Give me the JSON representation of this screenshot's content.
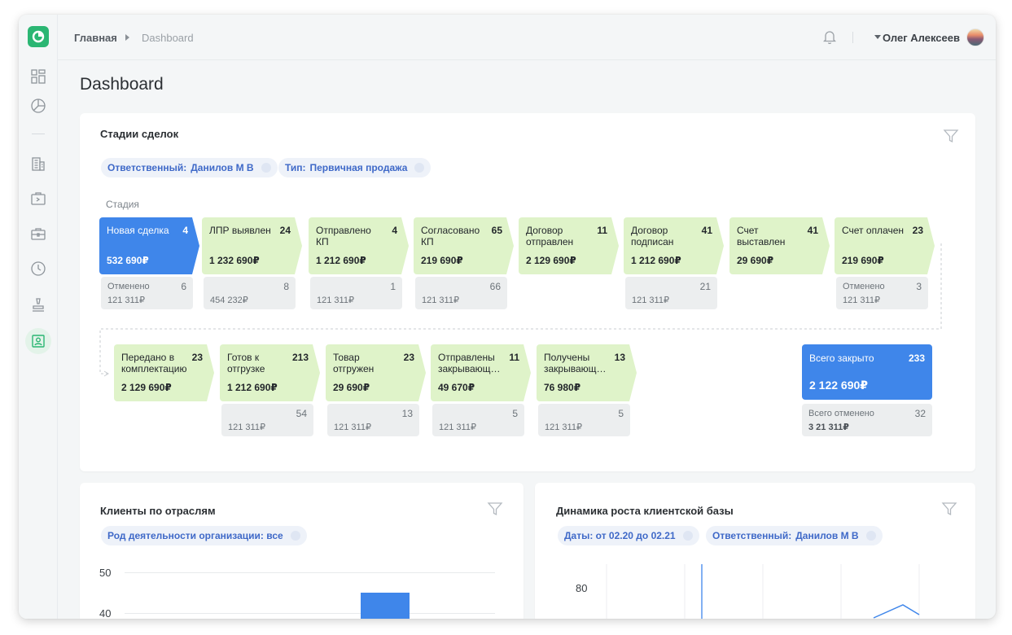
{
  "breadcrumb": {
    "home": "Главная",
    "current": "Dashboard"
  },
  "user": {
    "name": "Олег Алексеев"
  },
  "page": {
    "title": "Dashboard"
  },
  "sidebar": {
    "icons": [
      "dashboard-icon",
      "pie-chart-icon",
      "building-icon",
      "terminal-folder-icon",
      "briefcase-icon",
      "clock-icon",
      "stamp-icon",
      "contact-card-icon"
    ],
    "active": "contact-card-icon"
  },
  "deal_stages": {
    "title": "Стадии сделок",
    "filters": [
      {
        "label": "Ответственный:",
        "value": "Данилов М В"
      },
      {
        "label": "Тип:",
        "value": "Первичная продажа"
      }
    ],
    "stage_label": "Стадия",
    "row1": [
      {
        "name": "Новая сделка",
        "count": "4",
        "sum": "532 690₽",
        "active": true,
        "cancel": {
          "label": "Отменено",
          "count": "6",
          "sum": "121 311₽"
        }
      },
      {
        "name": "ЛПР выявлен",
        "count": "24",
        "sum": "1 232 690₽",
        "cancel": {
          "label": "",
          "count": "8",
          "sum": "454 232₽"
        }
      },
      {
        "name": "Отправлено КП",
        "count": "4",
        "sum": "1 212 690₽",
        "cancel": {
          "label": "",
          "count": "1",
          "sum": "121 311₽"
        }
      },
      {
        "name": "Согласовано КП",
        "count": "65",
        "sum": "219 690₽",
        "cancel": {
          "label": "",
          "count": "66",
          "sum": "121 311₽"
        }
      },
      {
        "name": "Договор отправлен",
        "count": "11",
        "sum": "2 129 690₽",
        "cancel": null
      },
      {
        "name": "Договор подписан",
        "count": "41",
        "sum": "1 212 690₽",
        "cancel": {
          "label": "",
          "count": "21",
          "sum": "121 311₽"
        }
      },
      {
        "name": "Счет выставлен",
        "count": "41",
        "sum": "29 690₽",
        "cancel": null
      },
      {
        "name": "Счет оплачен",
        "count": "23",
        "sum": "219 690₽",
        "cancel": {
          "label": "Отменено",
          "count": "3",
          "sum": "121 311₽"
        }
      }
    ],
    "row2": [
      {
        "name": "Передано в комплектацию",
        "count": "23",
        "sum": "2 129 690₽",
        "cancel": null
      },
      {
        "name": "Готов к отгрузке",
        "count": "213",
        "sum": "1 212 690₽",
        "cancel": {
          "label": "",
          "count": "54",
          "sum": "121 311₽"
        }
      },
      {
        "name": "Товар отгружен",
        "count": "23",
        "sum": "29 690₽",
        "cancel": {
          "label": "",
          "count": "13",
          "sum": "121 311₽"
        }
      },
      {
        "name": "Отправлены закрывающ…",
        "count": "11",
        "sum": "49 670₽",
        "cancel": {
          "label": "",
          "count": "5",
          "sum": "121 311₽"
        }
      },
      {
        "name": "Получены закрывающ…",
        "count": "13",
        "sum": "76 980₽",
        "cancel": {
          "label": "",
          "count": "5",
          "sum": "121 311₽"
        }
      }
    ],
    "total": {
      "label": "Всего закрыто",
      "count": "233",
      "sum": "2 122 690₽",
      "cancel_label": "Всего отменено",
      "cancel_count": "32",
      "cancel_sum": "3 21 311₽"
    }
  },
  "industries": {
    "title": "Клиенты по отраслям",
    "filter": "Род деятельности организации: все",
    "chart_data": {
      "type": "bar",
      "categories": [],
      "values": [
        45
      ],
      "ylabels": [
        "50",
        "40"
      ],
      "ylim": [
        40,
        50
      ],
      "grid": true,
      "color": "#3f86ea"
    }
  },
  "growth": {
    "title": "Динамика роста клиентской базы",
    "filters": [
      {
        "label": "Даты: от 02.20 до 02.21"
      },
      {
        "label": "Ответственный:",
        "value": "Данилов М В"
      }
    ],
    "chart_data": {
      "type": "line",
      "ylabels": [
        "80"
      ],
      "grid": true,
      "color": "#3f86ea"
    }
  },
  "colors": {
    "accent": "#3f86ea",
    "stage_green": "#dff3c9",
    "logo_green": "#2bb673"
  }
}
